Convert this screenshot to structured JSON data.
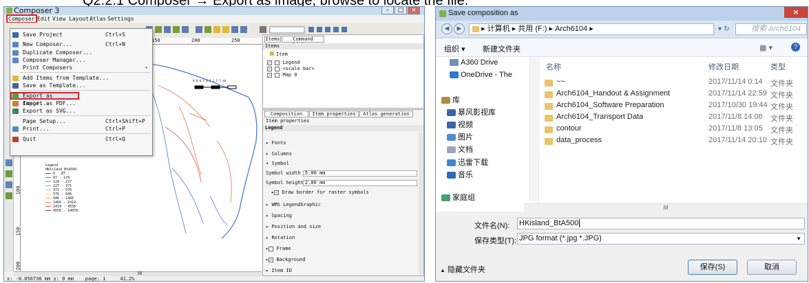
{
  "caption": "Q2.2.1 Composer → Export as image, browse to locate the file.",
  "left": {
    "title": "Composer 3",
    "menu": [
      "Composer",
      "Edit",
      "View",
      "Layout",
      "Atlas",
      "Settings"
    ],
    "dropdown": [
      {
        "label": "Save Project",
        "shortcut": "Ctrl+S"
      },
      {
        "label": "New Composer...",
        "shortcut": "Ctrl+N"
      },
      {
        "label": "Duplicate Composer...",
        "shortcut": ""
      },
      {
        "label": "Composer Manager...",
        "shortcut": ""
      },
      {
        "label": "Print Composers",
        "shortcut": ""
      },
      {
        "label": "Add Items from Template...",
        "shortcut": ""
      },
      {
        "label": "Save as Template...",
        "shortcut": ""
      },
      {
        "label": "Export as Image...",
        "shortcut": ""
      },
      {
        "label": "Export as PDF...",
        "shortcut": ""
      },
      {
        "label": "Export as SVG...",
        "shortcut": ""
      },
      {
        "label": "Page Setup...",
        "shortcut": "Ctrl+Shift+P"
      },
      {
        "label": "Print...",
        "shortcut": "Ctrl+P"
      },
      {
        "label": "Quit",
        "shortcut": "Ctrl+Q"
      }
    ],
    "ruler": [
      "150",
      "200",
      "250"
    ],
    "vruler": [
      "100",
      "150",
      "200"
    ],
    "items_tabs": [
      "Items",
      "Command history"
    ],
    "items_header": "Items",
    "items_col": "Item",
    "items": [
      "Legend",
      "<scale bar>",
      "Map 0"
    ],
    "prop_tabs": [
      "Composition",
      "Item properties",
      "Atlas generation"
    ],
    "prop_header": "Item properties",
    "prop_section": "Legend",
    "props": [
      "Fonts",
      "Columns",
      "Symbol",
      "Symbol width",
      "Symbol height",
      "Draw border for raster symbols",
      "WMS LegendGraphic",
      "Spacing",
      "Position and size",
      "Rotation",
      "Frame",
      "Background",
      "Item ID"
    ],
    "symbol_width": "5.00 mm",
    "symbol_height": "2.00 mm",
    "legend_title": "Legend",
    "legend_layer": "HKisland_BtA500",
    "legend_entries": [
      "0 - 87",
      "87 - 129",
      "129 - 227",
      "227 - 371",
      "371 - 576",
      "576 - 946",
      "946 - 1466",
      "1466 - 2419",
      "2419 - 4556",
      "4556 - 24870"
    ],
    "scale_labels": "0.0  0.5  0.1     1.5    2 km",
    "status": "x: -0.856736 mm y: 0 mm    page: 1     41.2%",
    "hscroll": "III"
  },
  "right": {
    "title": "Save composition as",
    "breadcrumb": "▸ 计算机 ▸ 共用 (F:) ▸ Arch6104 ▸",
    "search_placeholder": "搜索 Arch6104",
    "organize": "组织 ▾",
    "new_folder": "新建文件夹",
    "nav": [
      "A360 Drive",
      "OneDrive - The",
      "库",
      "暴风影视库",
      "视频",
      "图片",
      "文档",
      "迅雷下载",
      "音乐",
      "家庭组"
    ],
    "col_name": "名称",
    "col_date": "修改日期",
    "col_type": "类型",
    "files": [
      {
        "name": "~~",
        "date": "2017/11/14 0:14",
        "type": "文件夹"
      },
      {
        "name": "Arch6104_Handout & Assignment",
        "date": "2017/11/14 22:59",
        "type": "文件夹"
      },
      {
        "name": "Arch6104_Software Preparation",
        "date": "2017/10/30 19:44",
        "type": "文件夹"
      },
      {
        "name": "Arch6104_Transport Data",
        "date": "2017/11/8 14:06",
        "type": "文件夹"
      },
      {
        "name": "contour",
        "date": "2017/11/8 13:05",
        "type": "文件夹"
      },
      {
        "name": "data_process",
        "date": "2017/11/14 20:10",
        "type": "文件夹"
      }
    ],
    "hscroll": "III",
    "filename_label": "文件名(N):",
    "filename": "HKisland_BtA500",
    "type_label": "保存类型(T):",
    "type_value": "JPG format (*.jpg *.JPG)",
    "hide_folders": "隐藏文件夹",
    "save": "保存(S)",
    "cancel": "取消"
  },
  "colors": {
    "highlight": "#e21e1e",
    "selection": "#d7e6f7",
    "folder": "#e9c46a",
    "close": "#c9463d"
  }
}
